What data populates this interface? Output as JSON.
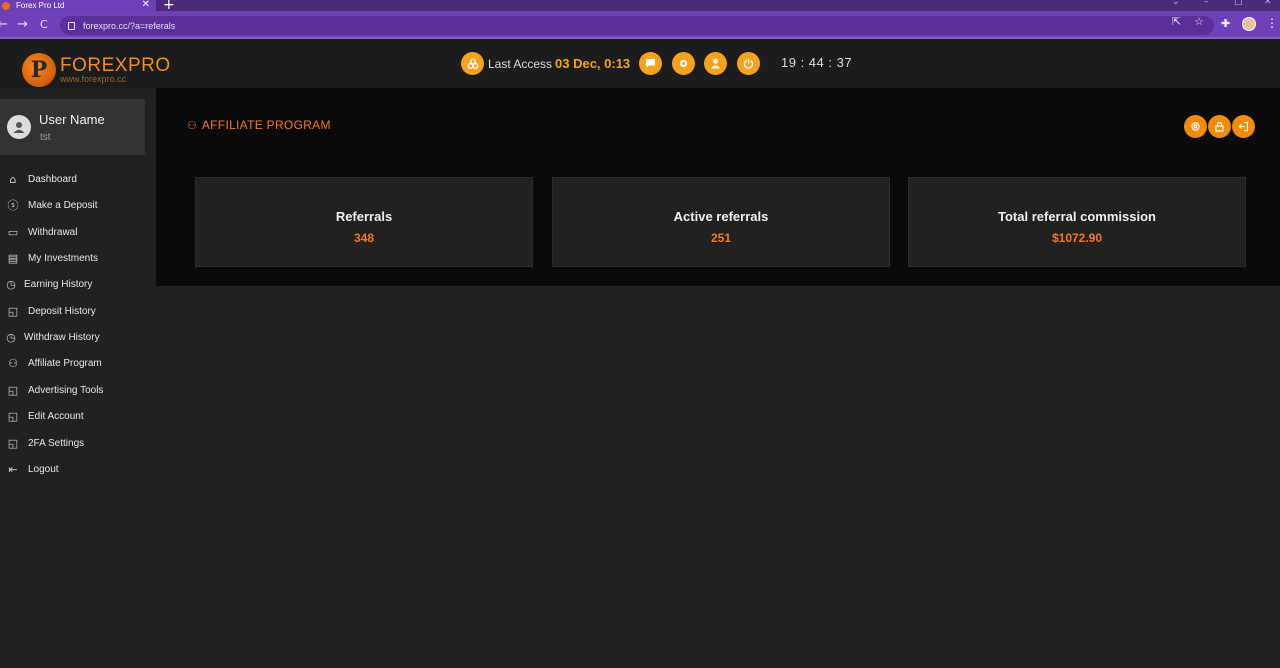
{
  "browser": {
    "tab_title": "Forex Pro Ltd",
    "tab_close": "✕",
    "new_tab": "+",
    "url": "forexpro.cc/?a=referals",
    "back": "←",
    "forward": "→",
    "reload": "C",
    "menu": "⋮"
  },
  "header": {
    "logo_mark": "P",
    "logo_name": "FOREXPRO",
    "logo_url": "www.forexpro.cc",
    "last_access_label": "Last Access",
    "last_access_date": "03 Dec, 0:13",
    "clock": "19 : 44 : 37"
  },
  "user": {
    "name": "User Name",
    "login": "tst"
  },
  "sidebar": {
    "items": [
      {
        "label": "Dashboard",
        "icon": "home-icon"
      },
      {
        "label": "Make a Deposit",
        "icon": "dollar-icon"
      },
      {
        "label": "Withdrawal",
        "icon": "wallet-icon"
      },
      {
        "label": "My Investments",
        "icon": "receipt-icon"
      },
      {
        "label": "Earning History",
        "icon": "history-icon"
      },
      {
        "label": "Deposit History",
        "icon": "chart-icon"
      },
      {
        "label": "Withdraw History",
        "icon": "history-icon"
      },
      {
        "label": "Affiliate Program",
        "icon": "users-icon"
      },
      {
        "label": "Advertising Tools",
        "icon": "chart-icon"
      },
      {
        "label": "Edit Account",
        "icon": "chart-icon"
      },
      {
        "label": "2FA Settings",
        "icon": "chart-icon"
      },
      {
        "label": "Logout",
        "icon": "logout-icon"
      }
    ]
  },
  "main": {
    "title": "AFFILIATE PROGRAM",
    "stats": [
      {
        "label": "Referrals",
        "value": "348"
      },
      {
        "label": "Active referrals",
        "value": "251"
      },
      {
        "label": "Total referral commission",
        "value": "$1072.90"
      }
    ]
  },
  "colors": {
    "accent": "#f5781f",
    "button": "#f5a31f",
    "chrome": "#7040b9"
  }
}
